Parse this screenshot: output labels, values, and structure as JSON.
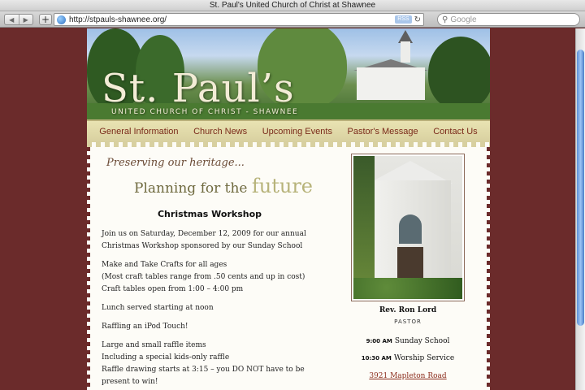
{
  "window": {
    "title": "St. Paul's United Church of Christ at Shawnee"
  },
  "toolbar": {
    "back_label": "◀",
    "forward_label": "▶",
    "add_label": "+",
    "url": "http://stpauls-shawnee.org/",
    "rss_label": "RSS",
    "reload_label": "↻",
    "search_placeholder": "Google",
    "search_glyph": "⚲"
  },
  "site": {
    "logo_title": "St. Paul’s",
    "logo_subtitle": "UNITED CHURCH OF CHRIST - SHAWNEE",
    "nav": [
      "General Information",
      "Church News",
      "Upcoming Events",
      "Pastor's Message",
      "Contact Us"
    ],
    "tagline_line1": "Preserving our heritage...",
    "tagline_line2_prefix": "Planning for the ",
    "tagline_line2_emphasis": "future"
  },
  "article": {
    "title": "Christmas Workshop",
    "paragraphs": [
      "Join us on Saturday, December 12, 2009 for our annual Christmas Workshop sponsored by our Sunday School",
      "Make and Take Crafts for all ages",
      "(Most craft tables range from .50 cents and up in cost)",
      "Craft tables open from 1:00 – 4:00 pm",
      "Lunch served starting at noon",
      "Raffling an iPod Touch!",
      "Large and small raffle items",
      "Including a special kids-only raffle",
      "Raffle drawing starts at 3:15 – you DO NOT have to be present to win!"
    ]
  },
  "sidebar": {
    "pastor_name": "Rev. Ron Lord",
    "pastor_role": "PASTOR",
    "services": [
      {
        "time": "9:00 AM",
        "name": "Sunday School"
      },
      {
        "time": "10:30 AM",
        "name": "Worship Service"
      }
    ],
    "address": "3921 Mapleton Road"
  },
  "colors": {
    "page_background": "#6b2b2b",
    "nav_link": "#7a2a1a",
    "nav_bar": "#e2dba9",
    "address_link": "#8b2c1c"
  }
}
